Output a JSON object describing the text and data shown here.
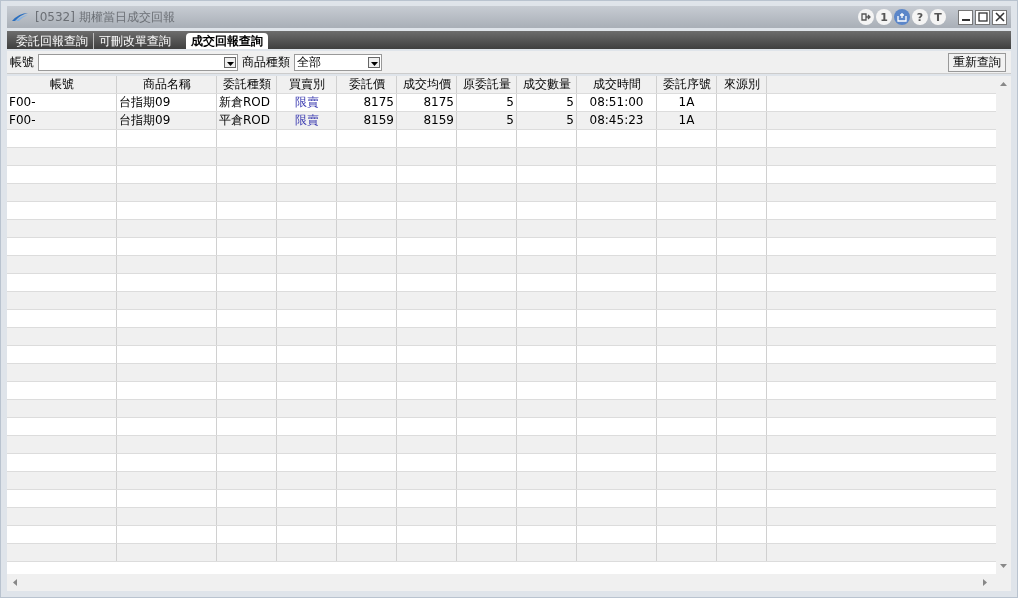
{
  "window": {
    "title": "[0532] 期權當日成交回報"
  },
  "title_icons": [
    {
      "kind": "exit"
    },
    {
      "kind": "glyph",
      "label": "1"
    },
    {
      "kind": "new"
    },
    {
      "kind": "glyph",
      "label": "?"
    },
    {
      "kind": "glyph",
      "label": "T"
    }
  ],
  "tabs": [
    {
      "label": "委託回報查詢",
      "selected": false
    },
    {
      "label": "可刪改單查詢",
      "selected": false
    },
    {
      "label": "成交回報查詢",
      "selected": true
    }
  ],
  "filters": {
    "account_label": "帳號",
    "product_label": "商品種類",
    "product_value": "全部",
    "refresh_button": "重新查詢"
  },
  "table": {
    "columns": [
      "帳號",
      "商品名稱",
      "委託種類",
      "買賣別",
      "委託價",
      "成交均價",
      "原委託量",
      "成交數量",
      "成交時間",
      "委託序號",
      "來源別"
    ],
    "rows": [
      [
        "F00-",
        "台指期09",
        "新倉ROD",
        "限賣",
        "8175",
        "8175",
        "5",
        "5",
        "08:51:00",
        "1A"
      ],
      [
        "F00-",
        "台指期09",
        "平倉ROD",
        "限賣",
        "8159",
        "8159",
        "5",
        "5",
        "08:45:23",
        "1A"
      ]
    ]
  }
}
